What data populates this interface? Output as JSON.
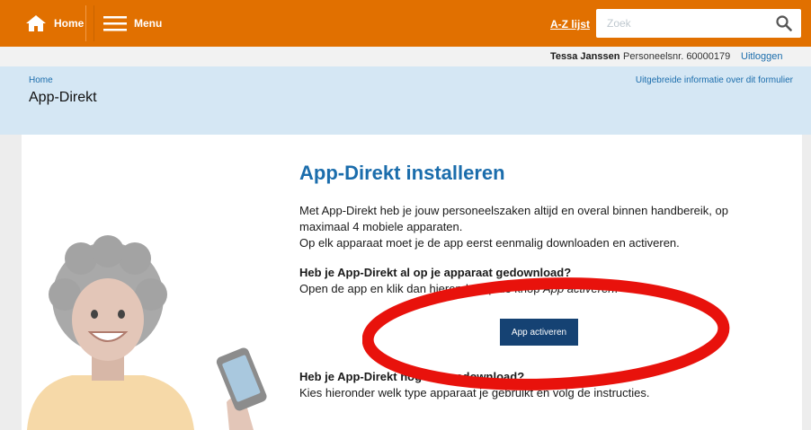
{
  "topbar": {
    "home_label": "Home",
    "menu_label": "Menu",
    "az_label": "A-Z lijst",
    "search_placeholder": "Zoek"
  },
  "userbar": {
    "name": "Tessa Janssen",
    "employee_no": "Personeelsnr. 60000179",
    "logout_label": "Uitloggen"
  },
  "banner": {
    "breadcrumb": "Home",
    "title": "App-Direkt",
    "info_link": "Uitgebreide informatie over dit formulier"
  },
  "content": {
    "heading": "App-Direkt installeren",
    "intro_line1": "Met App-Direkt heb je jouw personeelszaken altijd en overal binnen handbereik, op maximaal 4 mobiele apparaten.",
    "intro_line2": "Op elk apparaat moet je de app eerst eenmalig downloaden en activeren.",
    "question1": "Heb je App-Direkt al op je apparaat gedownload?",
    "answer1_prefix": "Open de app en klik dan hieronder op de knop ",
    "answer1_em": "App activeren",
    "answer1_suffix": ".",
    "activate_button": "App activeren",
    "question2": "Heb je App-Direkt nog niet gedownload?",
    "answer2": "Kies hieronder welk type apparaat je gebruikt en volg de instructies."
  },
  "colors": {
    "brand_orange": "#e17000",
    "link_blue": "#1b6dac",
    "button_navy": "#154273",
    "banner_blue": "#d5e7f4",
    "annotation_red": "#e8120c"
  },
  "icons": [
    "home-icon",
    "hamburger-menu-icon",
    "search-icon"
  ]
}
